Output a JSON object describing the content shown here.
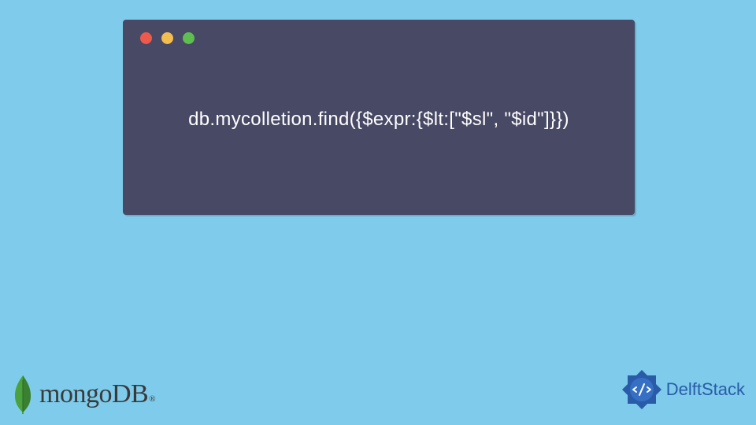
{
  "codeWindow": {
    "code": "db.mycolletion.find({$expr:{$lt:[\"$sl\", \"$id\"]}})"
  },
  "mongoLogo": {
    "text": "mongoDB",
    "trademark": "®"
  },
  "delftStack": {
    "text": "DelftStack"
  }
}
